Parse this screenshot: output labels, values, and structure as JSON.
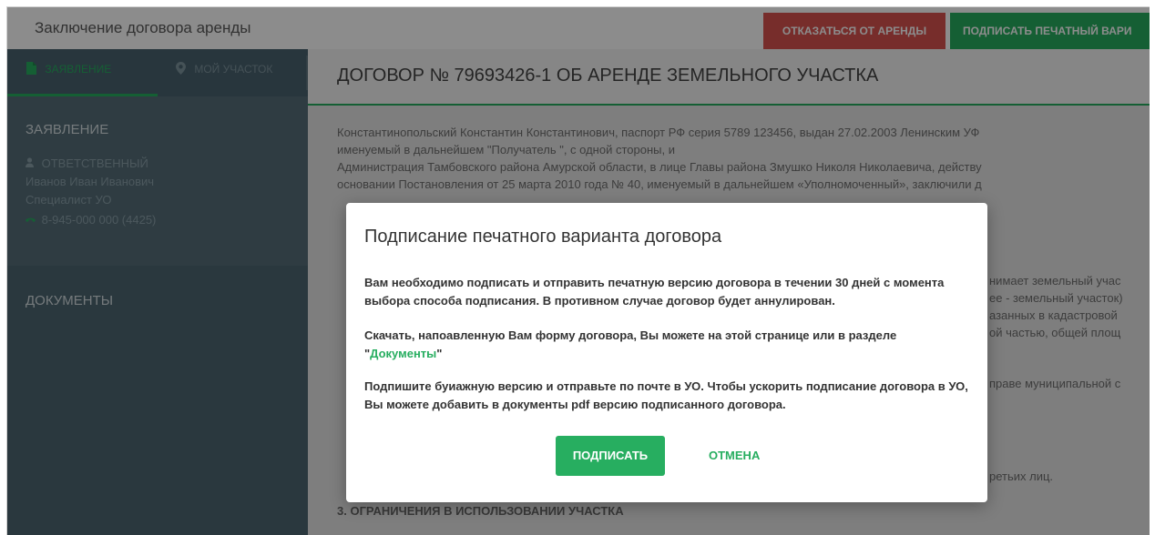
{
  "header": {
    "title": "Заключение договора аренды",
    "refuse_label": "ОТКАЗАТЬСЯ ОТ АРЕНДЫ",
    "sign_print_label": "ПОДПИСАТЬ ПЕЧАТНЫЙ ВАРИ"
  },
  "sidebar": {
    "tabs": [
      {
        "label": "ЗАЯВЛЕНИЕ",
        "icon": "document-icon"
      },
      {
        "label": "МОЙ УЧАСТОК",
        "icon": "map-pin-icon"
      }
    ],
    "collapse_icon": "‹",
    "section_title": "ЗАЯВЛЕНИЕ",
    "responsible_label": "ОТВЕТСТВЕННЫЙ",
    "responsible_name": "Иванов Иван Иванович",
    "responsible_role": "Специалист УО",
    "phone": "8-945-000 000 (4425)",
    "documents_title": "ДОКУМЕНТЫ"
  },
  "document": {
    "title": "ДОГОВОР № 79693426-1 ОБ АРЕНДЕ ЗЕМЕЛЬНОГО УЧАСТКА",
    "lines": [
      "Константинопольский Константин Константинович, паспорт РФ серия 5789 123456, выдан 27.02.2003 Ленинским УФ",
      "именуемый в дальнейшем \"Получатель \", с одной стороны, и",
      "Администрация Тамбовского района Амурской области, в лице Главы района Змушко Николя Николаевича, действу",
      "основании Постановления от 25 марта 2010 года № 40, именуемый в дальнейшем «Уполномоченный», заключили д"
    ],
    "fragments": [
      "нимает земельный учас",
      "ее - земельный участок)",
      "азанных в кадастровой",
      "ой частью, общей площ",
      "праве муниципальной с",
      "ретьих лиц."
    ],
    "section_heading": "3. ОГРАНИЧЕНИЯ В ИСПОЛЬЗОВАНИИ УЧАСТКА"
  },
  "modal": {
    "title": "Подписание печатного варианта договора",
    "p1": "Вам необходимо подписать и отправить печатную версию договора в течении 30 дней с момента выбора способа подписания. В противном случае договор будет аннулирован.",
    "p2_before": "Скачать, напоавленную Вам форму договора, Вы можете на этой странице или в разделе \"",
    "p2_link": "Документы",
    "p2_after": "\"",
    "p3": "Подпишите буиажную версию и отправьте по почте в УО. Чтобы ускорить подписание договора в УО, Вы можете добавить в документы pdf версию подписанного договора.",
    "sign_label": "ПОДПИСАТЬ",
    "cancel_label": "ОТМЕНА"
  },
  "colors": {
    "accent": "#27ae60",
    "danger": "#d9534f",
    "sidebar": "#4e6671"
  }
}
